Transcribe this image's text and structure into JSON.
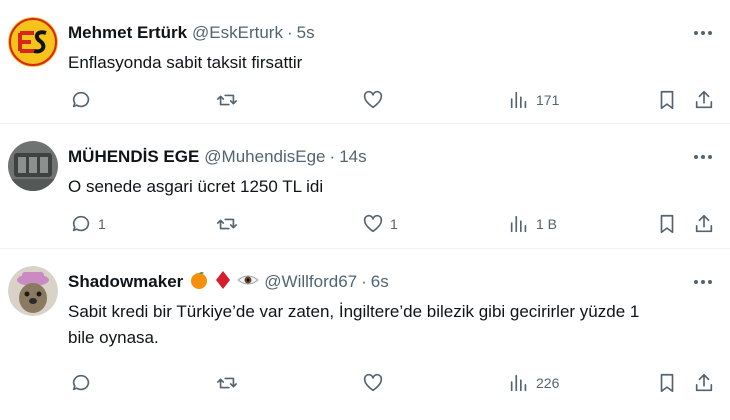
{
  "tweets": [
    {
      "name": "Mehmet Ertürk",
      "handle": "@EskErturk",
      "dot": "·",
      "time": "5s",
      "text": "Enflasyonda sabit taksit firsattir",
      "replies": "",
      "retweets": "",
      "likes": "",
      "views": "171",
      "avatar_colors": {
        "bg": "#f6c31a",
        "mark": "#d7261e"
      }
    },
    {
      "name": "MÜHENDİS EGE",
      "handle": "@MuhendisEge",
      "dot": "·",
      "time": "14s",
      "text": "O senede asgari ücret 1250 TL idi",
      "replies": "1",
      "retweets": "",
      "likes": "1",
      "views": "1 B",
      "avatar_colors": {
        "bg": "#6f7472",
        "mark": "#3e4241"
      }
    },
    {
      "name": "Shadowmaker",
      "handle": "@Willford67",
      "dot": "·",
      "time": "6s",
      "text_line1": "Sabit kredi bir Türkiye’de var zaten, İngiltere’de bilezik gibi gecirirler yüzde 1",
      "text_line2": "bile oynasa.",
      "replies": "",
      "retweets": "",
      "likes": "",
      "views": "226",
      "name_emojis": [
        "orange-emoji",
        "red-diamond-emoji",
        "eye-emoji"
      ],
      "avatar_colors": {
        "bg": "#d9d2c8",
        "hat": "#c98bc2",
        "face": "#8b7a60"
      }
    }
  ],
  "colors": {
    "text": "#0f1419",
    "muted": "#536471",
    "divider": "#eff3f4"
  }
}
